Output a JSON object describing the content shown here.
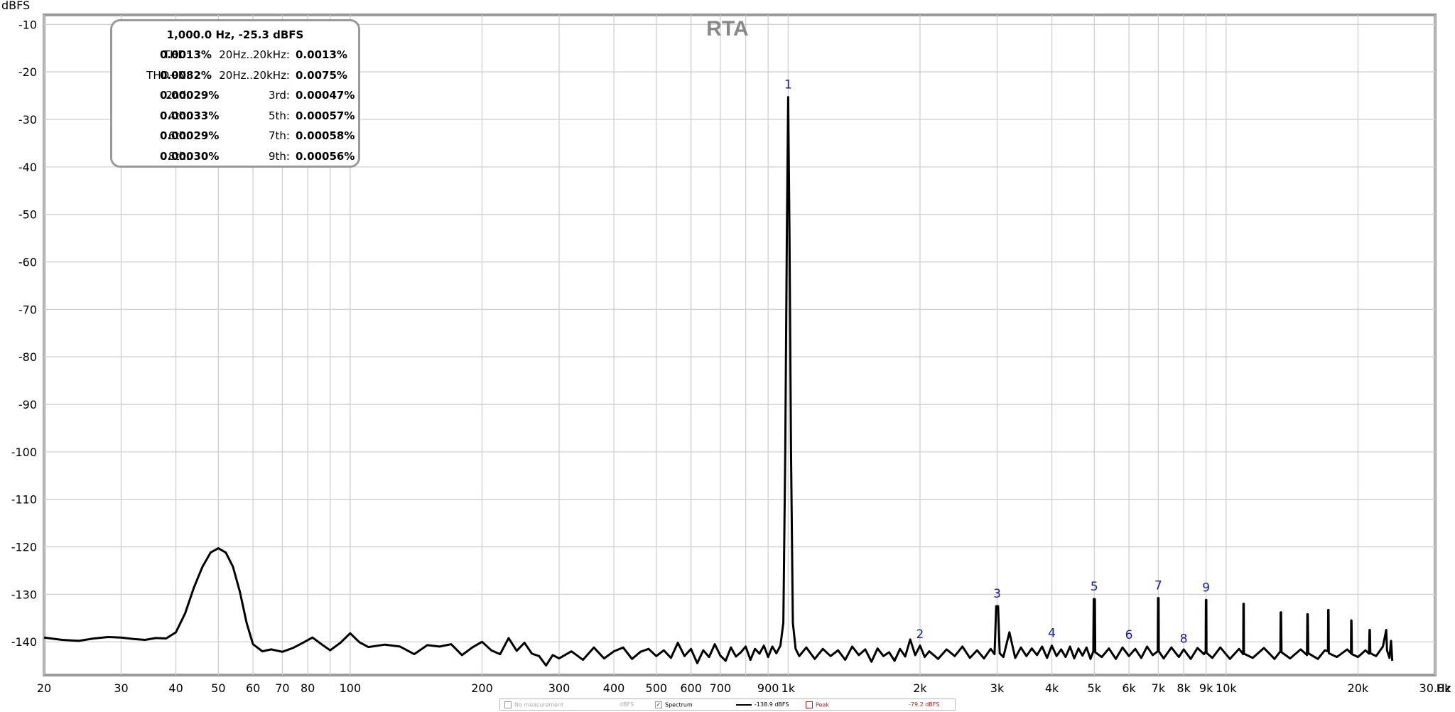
{
  "chart_data": {
    "type": "line",
    "title": "RTA",
    "ylabel": "dBFS",
    "xunit": "Hz",
    "xscale": "log",
    "xlim": [
      20,
      30000
    ],
    "ylim": [
      -147,
      -8
    ],
    "grid": true,
    "yticks": [
      -10,
      -20,
      -30,
      -40,
      -50,
      -60,
      -70,
      -80,
      -90,
      -100,
      -110,
      -120,
      -130,
      -140
    ],
    "xticks": [
      {
        "v": 20,
        "label": "20"
      },
      {
        "v": 30,
        "label": "30"
      },
      {
        "v": 40,
        "label": "40"
      },
      {
        "v": 50,
        "label": "50"
      },
      {
        "v": 60,
        "label": "60"
      },
      {
        "v": 70,
        "label": "70"
      },
      {
        "v": 80,
        "label": "80"
      },
      {
        "v": 100,
        "label": "100"
      },
      {
        "v": 200,
        "label": "200"
      },
      {
        "v": 300,
        "label": "300"
      },
      {
        "v": 400,
        "label": "400"
      },
      {
        "v": 500,
        "label": "500"
      },
      {
        "v": 600,
        "label": "600"
      },
      {
        "v": 700,
        "label": "700"
      },
      {
        "v": 900,
        "label": "900"
      },
      {
        "v": 1000,
        "label": "1k"
      },
      {
        "v": 2000,
        "label": "2k"
      },
      {
        "v": 3000,
        "label": "3k"
      },
      {
        "v": 4000,
        "label": "4k"
      },
      {
        "v": 5000,
        "label": "5k"
      },
      {
        "v": 6000,
        "label": "6k"
      },
      {
        "v": 7000,
        "label": "7k"
      },
      {
        "v": 8000,
        "label": "8k"
      },
      {
        "v": 9000,
        "label": "9k"
      },
      {
        "v": 10000,
        "label": "10k"
      },
      {
        "v": 20000,
        "label": "20k"
      },
      {
        "v": 30000,
        "label": "30.0k"
      }
    ],
    "xgrid": [
      20,
      30,
      40,
      50,
      60,
      70,
      80,
      90,
      100,
      200,
      300,
      400,
      500,
      600,
      700,
      800,
      900,
      1000,
      2000,
      3000,
      4000,
      5000,
      6000,
      7000,
      8000,
      9000,
      10000,
      20000,
      30000
    ],
    "series": [
      {
        "color": "#000000",
        "points": [
          [
            20,
            -139.1
          ],
          [
            22,
            -139.6
          ],
          [
            24,
            -139.8
          ],
          [
            26,
            -139.3
          ],
          [
            28,
            -139.0
          ],
          [
            30,
            -139.1
          ],
          [
            32,
            -139.4
          ],
          [
            34,
            -139.6
          ],
          [
            36,
            -139.2
          ],
          [
            38,
            -139.3
          ],
          [
            40,
            -138.0
          ],
          [
            42,
            -134.0
          ],
          [
            44,
            -128.5
          ],
          [
            46,
            -124.2
          ],
          [
            48,
            -121.2
          ],
          [
            50,
            -120.3
          ],
          [
            52,
            -121.2
          ],
          [
            54,
            -124.2
          ],
          [
            56,
            -129.5
          ],
          [
            58,
            -136.0
          ],
          [
            60,
            -140.5
          ],
          [
            63,
            -142.0
          ],
          [
            66,
            -141.6
          ],
          [
            70,
            -142.1
          ],
          [
            74,
            -141.3
          ],
          [
            78,
            -140.2
          ],
          [
            82,
            -139.1
          ],
          [
            86,
            -140.5
          ],
          [
            90,
            -141.8
          ],
          [
            95,
            -140.2
          ],
          [
            100,
            -138.2
          ],
          [
            105,
            -140.1
          ],
          [
            110,
            -141.1
          ],
          [
            120,
            -140.6
          ],
          [
            130,
            -141.0
          ],
          [
            140,
            -142.6
          ],
          [
            150,
            -140.7
          ],
          [
            160,
            -141.0
          ],
          [
            170,
            -140.5
          ],
          [
            180,
            -142.8
          ],
          [
            190,
            -141.2
          ],
          [
            200,
            -140.0
          ],
          [
            210,
            -141.8
          ],
          [
            220,
            -142.6
          ],
          [
            230,
            -139.2
          ],
          [
            240,
            -141.9
          ],
          [
            250,
            -140.2
          ],
          [
            260,
            -142.5
          ],
          [
            270,
            -143.0
          ],
          [
            280,
            -145.0
          ],
          [
            290,
            -142.8
          ],
          [
            300,
            -143.5
          ],
          [
            320,
            -142.0
          ],
          [
            340,
            -143.8
          ],
          [
            360,
            -141.2
          ],
          [
            380,
            -143.5
          ],
          [
            400,
            -142.0
          ],
          [
            420,
            -141.2
          ],
          [
            440,
            -143.6
          ],
          [
            460,
            -142.1
          ],
          [
            480,
            -141.5
          ],
          [
            500,
            -143.0
          ],
          [
            520,
            -141.8
          ],
          [
            540,
            -143.4
          ],
          [
            560,
            -140.2
          ],
          [
            580,
            -143.0
          ],
          [
            600,
            -141.5
          ],
          [
            620,
            -144.5
          ],
          [
            640,
            -141.8
          ],
          [
            660,
            -143.2
          ],
          [
            680,
            -140.5
          ],
          [
            700,
            -142.9
          ],
          [
            720,
            -144.0
          ],
          [
            740,
            -141.2
          ],
          [
            760,
            -143.1
          ],
          [
            780,
            -142.2
          ],
          [
            800,
            -141.0
          ],
          [
            820,
            -143.8
          ],
          [
            840,
            -141.5
          ],
          [
            860,
            -142.5
          ],
          [
            880,
            -140.8
          ],
          [
            900,
            -143.2
          ],
          [
            920,
            -141.0
          ],
          [
            940,
            -142.4
          ],
          [
            960,
            -140.8
          ],
          [
            975,
            -136.0
          ],
          [
            985,
            -100.0
          ],
          [
            993,
            -55.0
          ],
          [
            1000,
            -25.3
          ],
          [
            1007,
            -55.0
          ],
          [
            1015,
            -100.0
          ],
          [
            1025,
            -136.0
          ],
          [
            1040,
            -141.5
          ],
          [
            1060,
            -143.0
          ],
          [
            1100,
            -141.2
          ],
          [
            1150,
            -143.6
          ],
          [
            1200,
            -141.5
          ],
          [
            1250,
            -143.0
          ],
          [
            1300,
            -141.8
          ],
          [
            1350,
            -143.8
          ],
          [
            1400,
            -141.0
          ],
          [
            1450,
            -142.8
          ],
          [
            1500,
            -141.6
          ],
          [
            1550,
            -144.2
          ],
          [
            1600,
            -141.4
          ],
          [
            1650,
            -143.0
          ],
          [
            1700,
            -142.2
          ],
          [
            1750,
            -144.0
          ],
          [
            1800,
            -141.5
          ],
          [
            1850,
            -143.1
          ],
          [
            1900,
            -139.5
          ],
          [
            1950,
            -142.8
          ],
          [
            2000,
            -140.8
          ],
          [
            2050,
            -143.2
          ],
          [
            2100,
            -142.0
          ],
          [
            2200,
            -143.6
          ],
          [
            2300,
            -141.6
          ],
          [
            2400,
            -143.0
          ],
          [
            2500,
            -141.0
          ],
          [
            2600,
            -143.4
          ],
          [
            2700,
            -141.8
          ],
          [
            2800,
            -143.5
          ],
          [
            2900,
            -141.5
          ],
          [
            2960,
            -142.6
          ],
          [
            2985,
            -132.5
          ],
          [
            3015,
            -132.5
          ],
          [
            3040,
            -142.4
          ],
          [
            3100,
            -143.2
          ],
          [
            3200,
            -138.0
          ],
          [
            3300,
            -143.4
          ],
          [
            3400,
            -141.2
          ],
          [
            3500,
            -143.0
          ],
          [
            3600,
            -141.4
          ],
          [
            3700,
            -142.8
          ],
          [
            3800,
            -141.0
          ],
          [
            3900,
            -143.4
          ],
          [
            4000,
            -140.8
          ],
          [
            4100,
            -143.0
          ],
          [
            4200,
            -141.6
          ],
          [
            4300,
            -143.2
          ],
          [
            4400,
            -141.0
          ],
          [
            4500,
            -143.5
          ],
          [
            4600,
            -141.4
          ],
          [
            4700,
            -142.9
          ],
          [
            4800,
            -141.2
          ],
          [
            4900,
            -143.6
          ],
          [
            4975,
            -142.0
          ],
          [
            4985,
            -131.0
          ],
          [
            5015,
            -131.0
          ],
          [
            5025,
            -142.2
          ],
          [
            5200,
            -143.2
          ],
          [
            5400,
            -141.4
          ],
          [
            5600,
            -143.6
          ],
          [
            5800,
            -141.2
          ],
          [
            6000,
            -143.0
          ],
          [
            6200,
            -141.5
          ],
          [
            6400,
            -143.4
          ],
          [
            6600,
            -141.0
          ],
          [
            6800,
            -142.8
          ],
          [
            6980,
            -142.0
          ],
          [
            6990,
            -130.8
          ],
          [
            7010,
            -130.8
          ],
          [
            7020,
            -142.0
          ],
          [
            7200,
            -143.5
          ],
          [
            7500,
            -141.2
          ],
          [
            7800,
            -143.2
          ],
          [
            8000,
            -141.6
          ],
          [
            8300,
            -143.6
          ],
          [
            8600,
            -141.3
          ],
          [
            8900,
            -142.6
          ],
          [
            8980,
            -142.0
          ],
          [
            8990,
            -131.2
          ],
          [
            9010,
            -131.2
          ],
          [
            9020,
            -142.3
          ],
          [
            9300,
            -143.4
          ],
          [
            9700,
            -141.2
          ],
          [
            10200,
            -143.6
          ],
          [
            10700,
            -141.5
          ],
          [
            10940,
            -142.6
          ],
          [
            10950,
            -132.0
          ],
          [
            10970,
            -132.0
          ],
          [
            10980,
            -142.5
          ],
          [
            11500,
            -143.4
          ],
          [
            12200,
            -141.3
          ],
          [
            12900,
            -143.6
          ],
          [
            13300,
            -142.0
          ],
          [
            13320,
            -133.8
          ],
          [
            13350,
            -133.8
          ],
          [
            13380,
            -142.2
          ],
          [
            14000,
            -143.5
          ],
          [
            14800,
            -141.6
          ],
          [
            15300,
            -142.8
          ],
          [
            15330,
            -134.2
          ],
          [
            15360,
            -134.2
          ],
          [
            15400,
            -142.4
          ],
          [
            16200,
            -143.6
          ],
          [
            16800,
            -141.8
          ],
          [
            17080,
            -142.0
          ],
          [
            17100,
            -133.3
          ],
          [
            17130,
            -133.3
          ],
          [
            17160,
            -142.4
          ],
          [
            17900,
            -143.2
          ],
          [
            18900,
            -141.6
          ],
          [
            19280,
            -142.4
          ],
          [
            19300,
            -135.5
          ],
          [
            19330,
            -135.5
          ],
          [
            19370,
            -142.6
          ],
          [
            20000,
            -143.2
          ],
          [
            20800,
            -141.8
          ],
          [
            21200,
            -142.5
          ],
          [
            21250,
            -137.5
          ],
          [
            21290,
            -137.5
          ],
          [
            21340,
            -142.4
          ],
          [
            22000,
            -143.0
          ],
          [
            22800,
            -141.0
          ],
          [
            23200,
            -137.5
          ],
          [
            23300,
            -141.8
          ],
          [
            23600,
            -143.4
          ],
          [
            23800,
            -139.8
          ],
          [
            23950,
            -144.0
          ]
        ]
      }
    ],
    "harmonic_markers": [
      {
        "f": 1000,
        "db": -25.3,
        "label": "1"
      },
      {
        "f": 2000,
        "db": -141.0,
        "label": "2"
      },
      {
        "f": 3000,
        "db": -132.5,
        "label": "3"
      },
      {
        "f": 4000,
        "db": -140.8,
        "label": "4"
      },
      {
        "f": 5000,
        "db": -131.0,
        "label": "5"
      },
      {
        "f": 6000,
        "db": -141.2,
        "label": "6"
      },
      {
        "f": 7000,
        "db": -130.8,
        "label": "7"
      },
      {
        "f": 8000,
        "db": -142.0,
        "label": "8"
      },
      {
        "f": 9000,
        "db": -131.2,
        "label": "9"
      }
    ]
  },
  "stats": {
    "header": "1,000.0 Hz, -25.3 dBFS",
    "rows": [
      {
        "l1": "THD:",
        "v1": "0.0013%",
        "l2": "20Hz..20kHz:",
        "v2": "0.0013%"
      },
      {
        "l1": "THD+N:",
        "v1": "0.0082%",
        "l2": "20Hz..20kHz:",
        "v2": "0.0075%"
      },
      {
        "l1": "2nd:",
        "v1": "0.00029%",
        "l2": "3rd:",
        "v2": "0.00047%"
      },
      {
        "l1": "4th:",
        "v1": "0.00033%",
        "l2": "5th:",
        "v2": "0.00057%"
      },
      {
        "l1": "6th:",
        "v1": "0.00029%",
        "l2": "7th:",
        "v2": "0.00058%"
      },
      {
        "l1": "8th:",
        "v1": "0.00030%",
        "l2": "9th:",
        "v2": "0.00056%"
      }
    ]
  },
  "legend": {
    "no_measurement": "No measurement",
    "unit1": "dBFS",
    "spectrum_label": "Spectrum",
    "spectrum_value": "-138.9 dBFS",
    "peak_label": "Peak",
    "peak_value": "-79.2 dBFS",
    "peak_color": "#b22222"
  }
}
